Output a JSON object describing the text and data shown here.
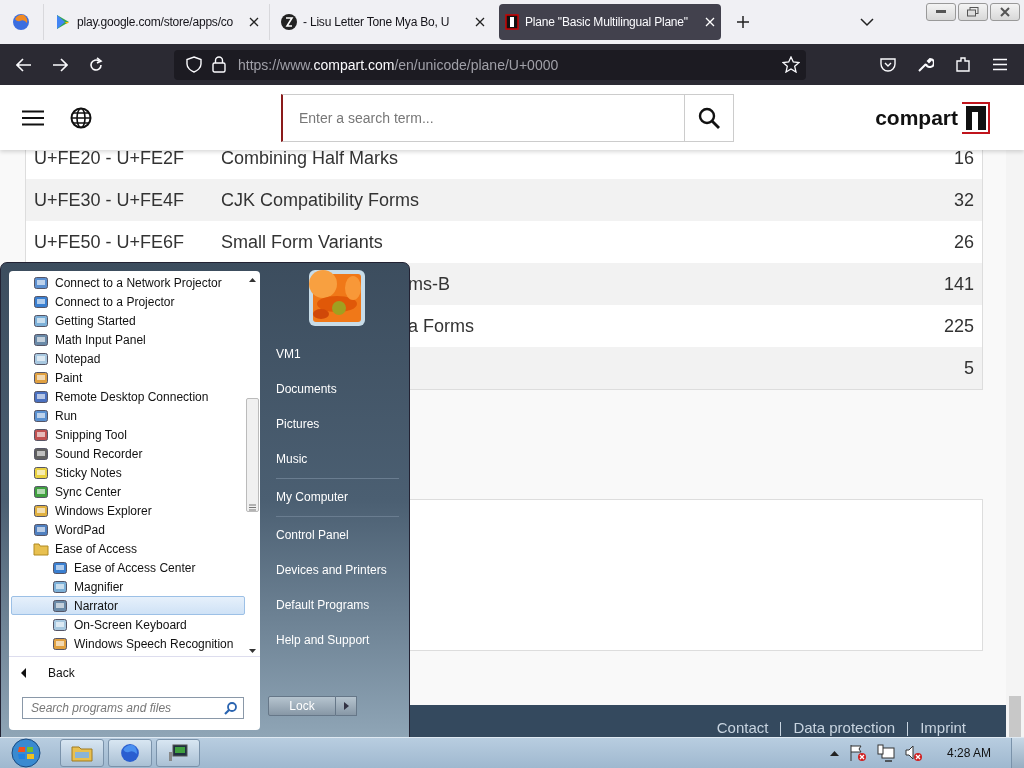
{
  "browser": {
    "tabs": [
      {
        "title": "play.google.com/store/apps/co",
        "kind": "play",
        "selected": false
      },
      {
        "title": "- Lisu Letter Tone Mya Bo, U",
        "kind": "glyph",
        "selected": false
      },
      {
        "title": "Plane \"Basic Multilingual Plane\"",
        "kind": "compart",
        "selected": true
      }
    ],
    "url": {
      "prefix": "https://www.",
      "host": "compart.com",
      "path": "/en/unicode/plane/U+0000"
    }
  },
  "site": {
    "search": {
      "placeholder": "Enter a search term..."
    },
    "logo": "compart"
  },
  "table": {
    "rows": [
      {
        "range": "U+FE20 - U+FE2F",
        "name": "Combining Half Marks",
        "count": "16"
      },
      {
        "range": "U+FE30 - U+FE4F",
        "name": "CJK Compatibility Forms",
        "count": "32"
      },
      {
        "range": "U+FE50 - U+FE6F",
        "name": "Small Form Variants",
        "count": "26"
      },
      {
        "name": "ms-B",
        "count": "141"
      },
      {
        "name": "a Forms",
        "count": "225"
      },
      {
        "count": "5"
      }
    ]
  },
  "footer": {
    "links": [
      "Contact",
      "Data protection",
      "Imprint"
    ]
  },
  "start_menu": {
    "programs": [
      {
        "label": "Connect to a Network Projector",
        "kind": "program",
        "selected": false
      },
      {
        "label": "Connect to a Projector",
        "kind": "program",
        "selected": false
      },
      {
        "label": "Getting Started",
        "kind": "program",
        "selected": false
      },
      {
        "label": "Math Input Panel",
        "kind": "program",
        "selected": false
      },
      {
        "label": "Notepad",
        "kind": "program",
        "selected": false
      },
      {
        "label": "Paint",
        "kind": "program",
        "selected": false
      },
      {
        "label": "Remote Desktop Connection",
        "kind": "program",
        "selected": false
      },
      {
        "label": "Run",
        "kind": "program",
        "selected": false
      },
      {
        "label": "Snipping Tool",
        "kind": "program",
        "selected": false
      },
      {
        "label": "Sound Recorder",
        "kind": "program",
        "selected": false
      },
      {
        "label": "Sticky Notes",
        "kind": "program",
        "selected": false
      },
      {
        "label": "Sync Center",
        "kind": "program",
        "selected": false
      },
      {
        "label": "Windows Explorer",
        "kind": "program",
        "selected": false
      },
      {
        "label": "WordPad",
        "kind": "program",
        "selected": false
      },
      {
        "label": "Ease of Access",
        "kind": "folder",
        "selected": false,
        "children": [
          {
            "label": "Ease of Access Center",
            "kind": "program",
            "selected": false
          },
          {
            "label": "Magnifier",
            "kind": "program",
            "selected": false
          },
          {
            "label": "Narrator",
            "kind": "program",
            "selected": true
          },
          {
            "label": "On-Screen Keyboard",
            "kind": "program",
            "selected": false
          },
          {
            "label": "Windows Speech Recognition",
            "kind": "program",
            "selected": false
          }
        ]
      }
    ],
    "back": "Back",
    "search": {
      "placeholder": "Search programs and files"
    },
    "places": [
      [
        "VM1",
        "Documents",
        "Pictures",
        "Music"
      ],
      [
        "My Computer"
      ],
      [
        "Control Panel",
        "Devices and Printers",
        "Default Programs",
        "Help and Support"
      ]
    ],
    "lock": "Lock"
  },
  "taskbar": {
    "clock": "4:28 AM"
  }
}
